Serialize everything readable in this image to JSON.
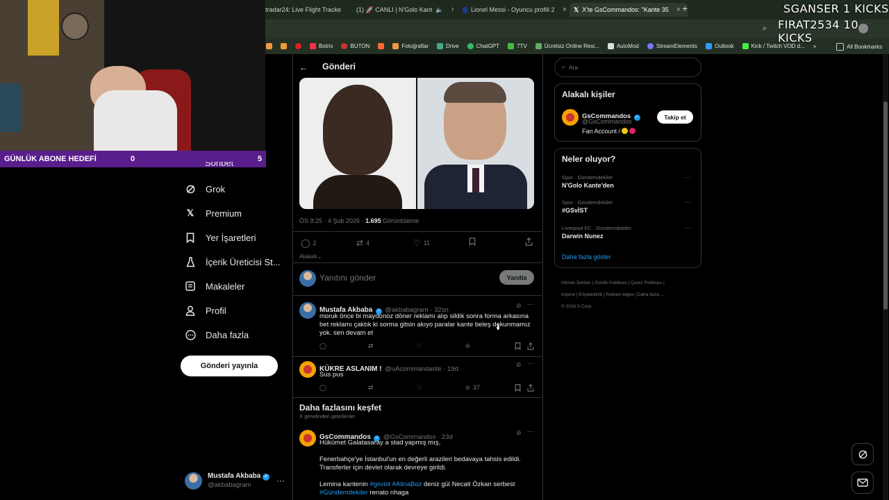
{
  "browser": {
    "tabs": [
      {
        "title": "tradar24: Live Flight Tracke",
        "active": false
      },
      {
        "title": "(1) 🚀 CANLI | N'Golo Kant",
        "active": false
      },
      {
        "title": "Lionel Messi - Oyuncu profili 2",
        "active": false
      },
      {
        "title": "X'te GsCommandos: \"Kante 35",
        "active": true
      }
    ],
    "bookmarks": [
      "Botrix",
      "BUTON",
      "Fotoğraflar",
      "Drive",
      "ChatGPT",
      "7TV",
      "Ücretsiz Online Resi...",
      "AutoMod",
      "StreamElements",
      "Outlook",
      "Kick / Twitch VOD d...",
      "All Bookmarks"
    ],
    "bookmark_colors": [
      "#e34",
      "#c33",
      "#e94",
      "#4a8",
      "#3b6",
      "#4b4",
      "#6a6",
      "#ddd",
      "#77f",
      "#39f",
      "#4e4",
      "#ccc"
    ]
  },
  "overlay": {
    "kicks_line1": "SGANSER  1 KICKS",
    "kicks_line2": "FIRAT2534  10 KICKS",
    "abone_label": "GÜNLÜK ABONE HEDEFİ",
    "abone_current": "0",
    "abone_goal": "5"
  },
  "nav": {
    "partial_item": "Sohbet",
    "items": [
      {
        "label": "Grok",
        "icon": "grok-icon"
      },
      {
        "label": "Premium",
        "icon": "x-logo-icon"
      },
      {
        "label": "Yer İşaretleri",
        "icon": "bookmark-icon"
      },
      {
        "label": "İçerik Üreticisi St...",
        "icon": "flask-icon"
      },
      {
        "label": "Makaleler",
        "icon": "article-icon"
      },
      {
        "label": "Profil",
        "icon": "profile-icon"
      },
      {
        "label": "Daha fazla",
        "icon": "more-circle-icon"
      }
    ],
    "post_button": "Gönderi yayınla",
    "account": {
      "name": "Mustafa Akbaba",
      "handle": "@akbabagram"
    }
  },
  "post": {
    "header_title": "Gönderi",
    "meta_time": "ÖS 9:25 · 4 Şub 2026 · ",
    "meta_views": "1.695",
    "meta_views_label": " Görüntüleme",
    "replies": "2",
    "reposts": "4",
    "likes": "11",
    "relevance": "Alakalı",
    "reply_placeholder": "Yanıtını gönder",
    "reply_button": "Yanıtla"
  },
  "replies": [
    {
      "name": "Mustafa Akbaba",
      "handle": "@akbabagram · 32sn",
      "text": "moruk önce bi maydonoz döner reklamı alıp sildik sonra forma arkasına bet reklamı çaktık ki sorma gitsin akıyo paralar kante beleş dokunmamız yok. sen devam et",
      "views": ""
    },
    {
      "name": "KÜKRE ASLANIM !",
      "handle": "@uAcommandante · 19d",
      "text": "Sus pus",
      "views": "37"
    }
  ],
  "discover": {
    "title": "Daha fazlasını keşfet",
    "subtitle": "X genelinden getirilenler",
    "post": {
      "name": "GsCommandos",
      "handle": "@GsCommandos · 23d",
      "line1": "Hükümet Galatasaray a stad yapmış mış,",
      "line2": "Fenerbahçe'ye İstanbul'un en değerli arazileri bedavaya tahsis edildi.",
      "line3": "Transferler için devlet olarak devreye girildi.",
      "line4_pre": "Lemina kantenin ",
      "line4_tag1": "#gsvist",
      "line4_tag2": " #AlinaBoz",
      "line4_post": " deniz gül Necati Özkan serbest",
      "line5_tag": "#Gündemdekiler",
      "line5_post": " renato nhaga"
    }
  },
  "right": {
    "search_placeholder": "Ara",
    "related_title": "Alakalı kişiler",
    "related": {
      "name": "GsCommandos",
      "handle": "@GsCommandos",
      "bio": "Fan Account /",
      "follow": "Takip et"
    },
    "trends_title": "Neler oluyor?",
    "trends": [
      {
        "category": "Spor · Gündemdekiler",
        "title": "N'Golo Kante'den"
      },
      {
        "category": "Spor · Gündemdekiler",
        "title": "#GSvİST"
      },
      {
        "category": "Liverpool FC · Gündemdekiler",
        "title": "Darwin Nunez"
      }
    ],
    "show_more": "Daha fazla göster",
    "footer": [
      "Hizmet Şartları",
      "Gizlilik Politikası",
      "Çerez Politikası",
      "Imprint",
      "Erişilebilirlik",
      "Reklam bilgisi",
      "Daha fazla ...",
      "© 2026 X Corp."
    ]
  },
  "colors": {
    "accent": "#1d9bf0",
    "purple": "#5a1d8c",
    "gs_avatar": "#f4a200"
  }
}
